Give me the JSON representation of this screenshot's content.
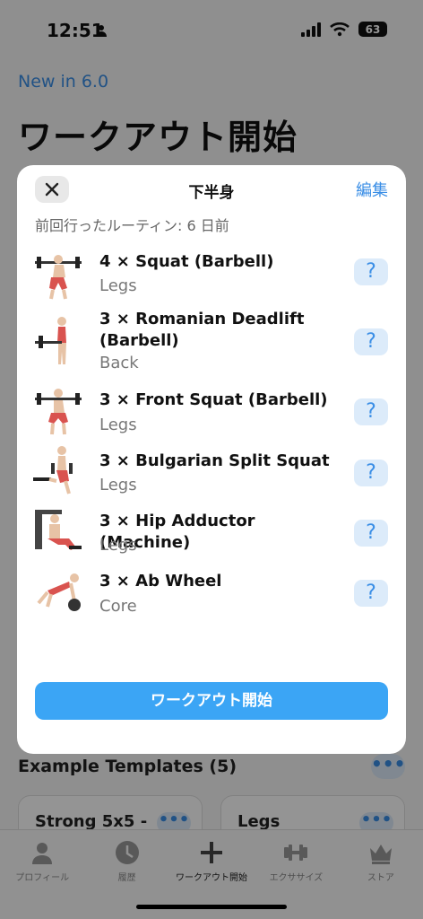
{
  "status_bar": {
    "time": "12:51",
    "battery": "63"
  },
  "page": {
    "new_in": "New in 6.0",
    "title": "ワークアウト開始"
  },
  "example_templates": {
    "title": "Example Templates (5)",
    "more": "•••",
    "cards": [
      {
        "name": "Strong 5x5 -",
        "dots": "•••"
      },
      {
        "name": "Legs",
        "dots": "•••"
      }
    ]
  },
  "tab_bar": {
    "tabs": [
      {
        "label": "プロフィール",
        "icon": "person-icon"
      },
      {
        "label": "履歴",
        "icon": "clock-icon"
      },
      {
        "label": "ワークアウト開始",
        "icon": "plus-icon"
      },
      {
        "label": "エクササイズ",
        "icon": "dumbbell-icon"
      },
      {
        "label": "ストア",
        "icon": "crown-icon"
      }
    ]
  },
  "modal": {
    "title": "下半身",
    "edit": "編集",
    "last_done": "前回行ったルーティン: 6 日前",
    "help": "?",
    "start_button": "ワークアウト開始",
    "exercises": [
      {
        "name": "4 × Squat (Barbell)",
        "category": "Legs"
      },
      {
        "name": "3 × Romanian Deadlift (Barbell)",
        "category": "Back"
      },
      {
        "name": "3 × Front Squat (Barbell)",
        "category": "Legs"
      },
      {
        "name": "3 × Bulgarian Split Squat",
        "category": "Legs"
      },
      {
        "name": "3 × Hip Adductor (Machine)",
        "category": "Legs"
      },
      {
        "name": "3 × Ab Wheel",
        "category": "Core"
      }
    ]
  },
  "colors": {
    "accent": "#3a8ee6",
    "button": "#3ba5f5",
    "muscle": "#d9534f"
  }
}
